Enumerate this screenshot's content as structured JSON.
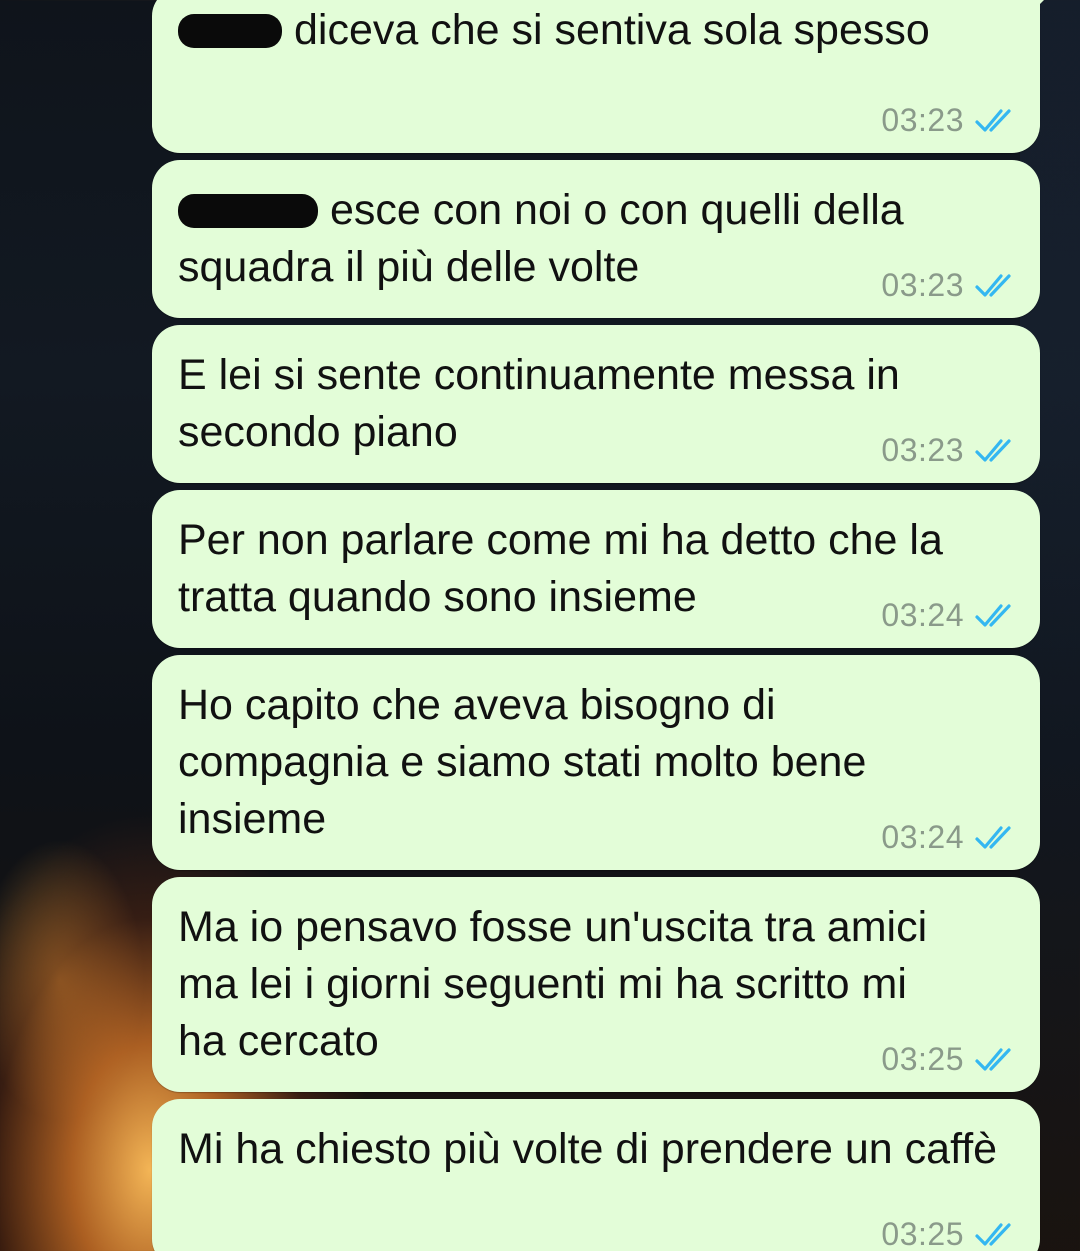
{
  "theme": {
    "bubble_color": "#e3fdd8",
    "tick_color": "#34b7f1",
    "time_color": "#8a9a8a"
  },
  "messages": [
    {
      "text": "diceva che si sentiva sola spesso",
      "time": "03:23",
      "status": "read",
      "redacted_prefix": true
    },
    {
      "text": "esce con noi o con quelli della squadra il più delle volte",
      "time": "03:23",
      "status": "read",
      "redacted_prefix": true
    },
    {
      "text": "E lei si sente continuamente messa in secondo piano",
      "time": "03:23",
      "status": "read"
    },
    {
      "text": "Per non parlare come mi ha detto che la tratta quando sono insieme",
      "time": "03:24",
      "status": "read"
    },
    {
      "text": "Ho capito che aveva bisogno di compagnia e siamo stati molto bene insieme",
      "time": "03:24",
      "status": "read"
    },
    {
      "text": "Ma io pensavo fosse un'uscita tra amici ma lei i giorni seguenti mi ha scritto mi ha cercato",
      "time": "03:25",
      "status": "read"
    },
    {
      "text": "Mi ha chiesto più volte di prendere un caffè",
      "time": "03:25",
      "status": "read"
    }
  ]
}
